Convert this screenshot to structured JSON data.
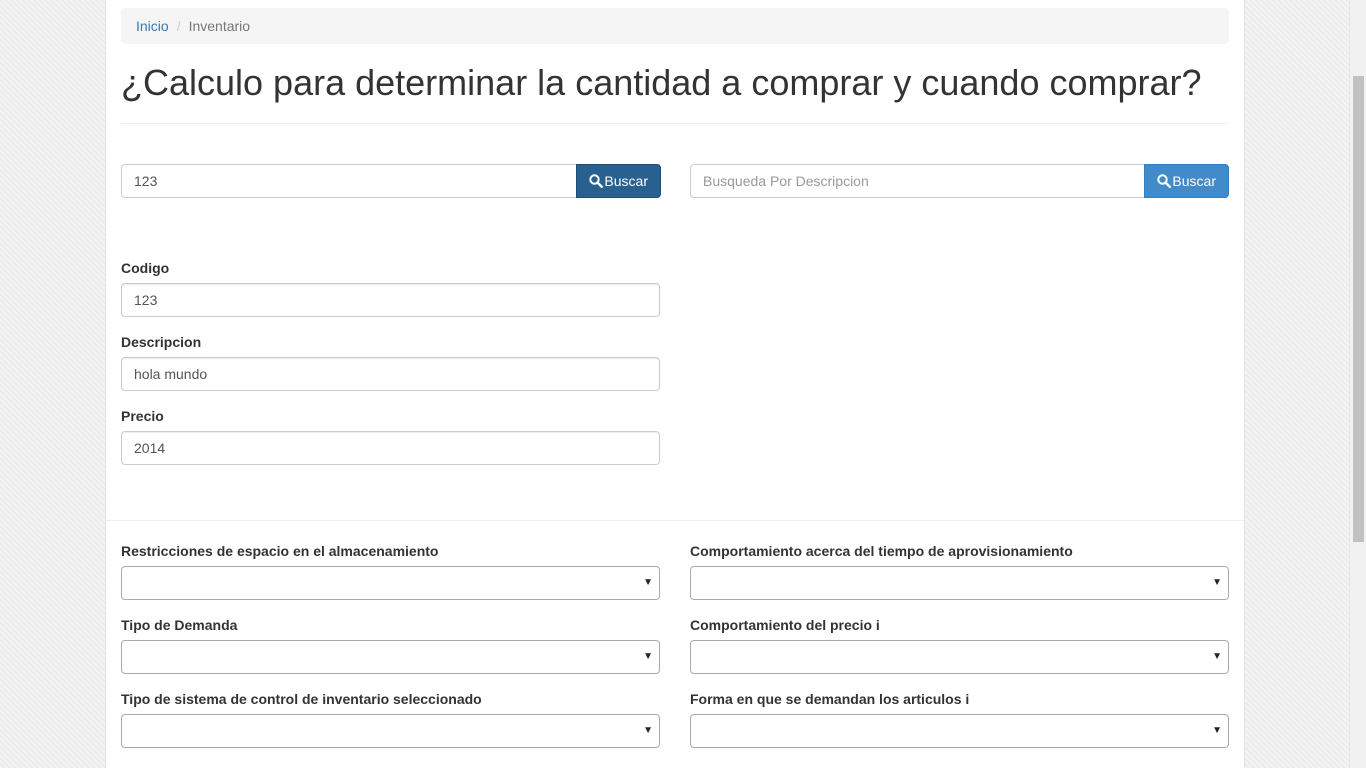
{
  "breadcrumb": {
    "home": "Inicio",
    "separator": "/",
    "current": "Inventario"
  },
  "title": "¿Calculo para determinar la cantidad a comprar y cuando comprar?",
  "search_code": {
    "value": "123",
    "button": "Buscar",
    "icon": "search-icon"
  },
  "search_desc": {
    "placeholder": "Busqueda Por Descripcion",
    "value": "",
    "button": "Buscar",
    "icon": "search-icon"
  },
  "form": {
    "codigo": {
      "label": "Codigo",
      "value": "123"
    },
    "descripcion": {
      "label": "Descripcion",
      "value": "hola mundo"
    },
    "precio": {
      "label": "Precio",
      "value": "2014"
    }
  },
  "selects": {
    "restricciones": {
      "label": "Restricciones de espacio en el almacenamiento",
      "value": ""
    },
    "tiempo": {
      "label": "Comportamiento acerca del tiempo de aprovisionamiento",
      "value": ""
    },
    "demanda": {
      "label": "Tipo de Demanda",
      "value": ""
    },
    "precio_i": {
      "label": "Comportamiento del precio i",
      "value": ""
    },
    "sistema": {
      "label": "Tipo de sistema de control de inventario seleccionado",
      "value": ""
    },
    "forma": {
      "label": "Forma en que se demandan los articulos i",
      "value": ""
    }
  },
  "colors": {
    "primary_dark": "#286090",
    "primary": "#428bca",
    "link": "#337ab7"
  }
}
